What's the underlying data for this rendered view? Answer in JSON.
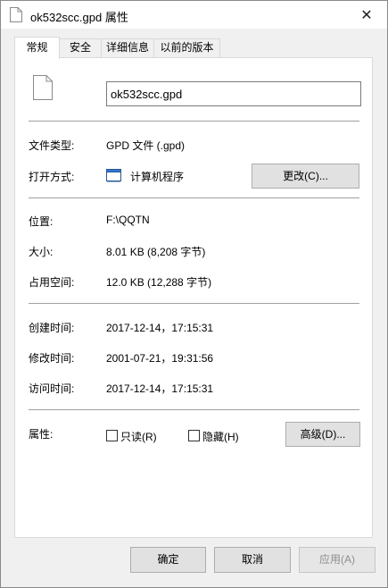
{
  "window": {
    "title": "ok532scc.gpd 属性",
    "close_glyph": "✕"
  },
  "tabs": [
    {
      "label": "常规",
      "active": true
    },
    {
      "label": "安全",
      "active": false
    },
    {
      "label": "详细信息",
      "active": false
    },
    {
      "label": "以前的版本",
      "active": false
    }
  ],
  "general": {
    "file_name": "ok532scc.gpd",
    "file_type": {
      "label": "文件类型:",
      "value": "GPD 文件 (.gpd)"
    },
    "opens_with": {
      "label": "打开方式:",
      "value": "计算机程序",
      "change_button": "更改(C)..."
    },
    "location": {
      "label": "位置:",
      "value": "F:\\QQTN"
    },
    "size": {
      "label": "大小:",
      "value": "8.01 KB (8,208 字节)"
    },
    "size_on_disk": {
      "label": "占用空间:",
      "value": "12.0 KB (12,288 字节)"
    },
    "created": {
      "label": "创建时间:",
      "value": "2017-12-14，17:15:31"
    },
    "modified": {
      "label": "修改时间:",
      "value": "2001-07-21，19:31:56"
    },
    "accessed": {
      "label": "访问时间:",
      "value": "2017-12-14，17:15:31"
    },
    "attributes": {
      "label": "属性:",
      "readonly": {
        "label": "只读(R)",
        "checked": false
      },
      "hidden": {
        "label": "隐藏(H)",
        "checked": false
      },
      "advanced_button": "高级(D)..."
    }
  },
  "footer": {
    "ok": "确定",
    "cancel": "取消",
    "apply": "应用(A)"
  }
}
